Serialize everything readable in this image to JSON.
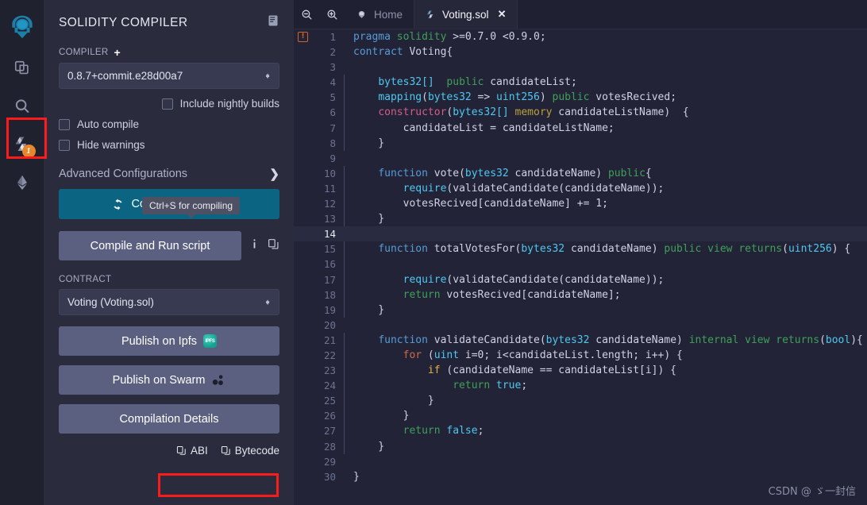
{
  "rail": {
    "items": [
      {
        "name": "remix-logo",
        "label": "Remix"
      },
      {
        "name": "file-explorer",
        "label": "File explorers"
      },
      {
        "name": "search",
        "label": "Search in files"
      },
      {
        "name": "solidity-compiler",
        "label": "Solidity compiler",
        "badge": "1"
      },
      {
        "name": "deploy-run",
        "label": "Deploy & run transactions"
      }
    ]
  },
  "panel": {
    "title": "SOLIDITY COMPILER",
    "header_icon": "book-icon",
    "compiler_label": "COMPILER",
    "compiler_add_icon": "plus-icon",
    "compiler_version": "0.8.7+commit.e28d00a7",
    "nightly_label": "Include nightly builds",
    "auto_compile_label": "Auto compile",
    "hide_warnings_label": "Hide warnings",
    "advanced_label": "Advanced Configurations",
    "tooltip": "Ctrl+S for compiling",
    "compile_button": "Compile Voting.sol",
    "compile_icon": "refresh-icon",
    "run_script_button": "Compile and Run script",
    "info_icon": "info-icon",
    "copy_icon": "copy-icon",
    "contract_label": "CONTRACT",
    "contract_value": "Voting (Voting.sol)",
    "publish_ipfs": "Publish on Ipfs",
    "publish_swarm": "Publish on Swarm",
    "compilation_details": "Compilation Details",
    "abi_label": "ABI",
    "bytecode_label": "Bytecode"
  },
  "editor": {
    "zoom_out_icon": "zoom-out-icon",
    "zoom_in_icon": "zoom-in-icon",
    "tabs": [
      {
        "label": "Home",
        "icon": "remix-home-icon",
        "active": false,
        "closable": false
      },
      {
        "label": "Voting.sol",
        "icon": "solidity-file-icon",
        "active": true,
        "closable": true,
        "close_icon": "close-icon"
      }
    ],
    "active_line": 14,
    "warning_line": 1,
    "warning_icon": "warning-marker-icon",
    "lines": [
      {
        "n": 1,
        "tokens": [
          {
            "t": "pragma ",
            "c": "t-kw"
          },
          {
            "t": "solidity ",
            "c": "t-mod"
          },
          {
            "t": ">=0.7.0 <0.9.0;",
            "c": "t-plain"
          }
        ]
      },
      {
        "n": 2,
        "tokens": [
          {
            "t": "contract ",
            "c": "t-kw"
          },
          {
            "t": "Voting{",
            "c": "t-plain"
          }
        ]
      },
      {
        "n": 3,
        "tokens": []
      },
      {
        "n": 4,
        "indent": 1,
        "tokens": [
          {
            "t": "    ",
            "c": "t-plain"
          },
          {
            "t": "bytes32[]",
            "c": "t-type"
          },
          {
            "t": "  ",
            "c": "t-plain"
          },
          {
            "t": "public",
            "c": "t-mod"
          },
          {
            "t": " candidateList;",
            "c": "t-plain"
          }
        ]
      },
      {
        "n": 5,
        "indent": 1,
        "tokens": [
          {
            "t": "    ",
            "c": "t-plain"
          },
          {
            "t": "mapping",
            "c": "t-type"
          },
          {
            "t": "(",
            "c": "t-plain"
          },
          {
            "t": "bytes32",
            "c": "t-type"
          },
          {
            "t": " => ",
            "c": "t-plain"
          },
          {
            "t": "uint256",
            "c": "t-type"
          },
          {
            "t": ") ",
            "c": "t-plain"
          },
          {
            "t": "public",
            "c": "t-mod"
          },
          {
            "t": " votesRecived;",
            "c": "t-plain"
          }
        ]
      },
      {
        "n": 6,
        "indent": 1,
        "tokens": [
          {
            "t": "    ",
            "c": "t-plain"
          },
          {
            "t": "constructor",
            "c": "t-fn"
          },
          {
            "t": "(",
            "c": "t-plain"
          },
          {
            "t": "bytes32[]",
            "c": "t-type"
          },
          {
            "t": " ",
            "c": "t-plain"
          },
          {
            "t": "memory",
            "c": "t-mem"
          },
          {
            "t": " candidateListName)  {",
            "c": "t-plain"
          }
        ]
      },
      {
        "n": 7,
        "indent": 2,
        "tokens": [
          {
            "t": "        candidateList = candidateListName;",
            "c": "t-plain"
          }
        ]
      },
      {
        "n": 8,
        "indent": 1,
        "tokens": [
          {
            "t": "    }",
            "c": "t-plain"
          }
        ]
      },
      {
        "n": 9,
        "tokens": []
      },
      {
        "n": 10,
        "indent": 1,
        "tokens": [
          {
            "t": "    ",
            "c": "t-plain"
          },
          {
            "t": "function",
            "c": "t-kw"
          },
          {
            "t": " vote(",
            "c": "t-plain"
          },
          {
            "t": "bytes32",
            "c": "t-type"
          },
          {
            "t": " candidateName) ",
            "c": "t-plain"
          },
          {
            "t": "public",
            "c": "t-mod"
          },
          {
            "t": "{",
            "c": "t-plain"
          }
        ]
      },
      {
        "n": 11,
        "indent": 2,
        "tokens": [
          {
            "t": "        ",
            "c": "t-plain"
          },
          {
            "t": "require",
            "c": "t-type"
          },
          {
            "t": "(validateCandidate(candidateName));",
            "c": "t-plain"
          }
        ]
      },
      {
        "n": 12,
        "indent": 2,
        "tokens": [
          {
            "t": "        votesRecived[candidateName] += 1;",
            "c": "t-plain"
          }
        ]
      },
      {
        "n": 13,
        "indent": 1,
        "tokens": [
          {
            "t": "    }",
            "c": "t-plain"
          }
        ]
      },
      {
        "n": 14,
        "tokens": []
      },
      {
        "n": 15,
        "indent": 1,
        "tokens": [
          {
            "t": "    ",
            "c": "t-plain"
          },
          {
            "t": "function",
            "c": "t-kw"
          },
          {
            "t": " totalVotesFor(",
            "c": "t-plain"
          },
          {
            "t": "bytes32",
            "c": "t-type"
          },
          {
            "t": " candidateName) ",
            "c": "t-plain"
          },
          {
            "t": "public",
            "c": "t-mod"
          },
          {
            "t": " ",
            "c": "t-plain"
          },
          {
            "t": "view",
            "c": "t-mod"
          },
          {
            "t": " ",
            "c": "t-plain"
          },
          {
            "t": "returns",
            "c": "t-ret"
          },
          {
            "t": "(",
            "c": "t-plain"
          },
          {
            "t": "uint256",
            "c": "t-type"
          },
          {
            "t": ") {",
            "c": "t-plain"
          }
        ]
      },
      {
        "n": 16,
        "indent": 2,
        "tokens": []
      },
      {
        "n": 17,
        "indent": 2,
        "tokens": [
          {
            "t": "        ",
            "c": "t-plain"
          },
          {
            "t": "require",
            "c": "t-type"
          },
          {
            "t": "(validateCandidate(candidateName));",
            "c": "t-plain"
          }
        ]
      },
      {
        "n": 18,
        "indent": 2,
        "tokens": [
          {
            "t": "        ",
            "c": "t-plain"
          },
          {
            "t": "return",
            "c": "t-ret"
          },
          {
            "t": " votesRecived[candidateName];",
            "c": "t-plain"
          }
        ]
      },
      {
        "n": 19,
        "indent": 1,
        "tokens": [
          {
            "t": "    }",
            "c": "t-plain"
          }
        ]
      },
      {
        "n": 20,
        "tokens": []
      },
      {
        "n": 21,
        "indent": 1,
        "tokens": [
          {
            "t": "    ",
            "c": "t-plain"
          },
          {
            "t": "function",
            "c": "t-kw"
          },
          {
            "t": " validateCandidate(",
            "c": "t-plain"
          },
          {
            "t": "bytes32",
            "c": "t-type"
          },
          {
            "t": " candidateName) ",
            "c": "t-plain"
          },
          {
            "t": "internal",
            "c": "t-mod"
          },
          {
            "t": " ",
            "c": "t-plain"
          },
          {
            "t": "view",
            "c": "t-mod"
          },
          {
            "t": " ",
            "c": "t-plain"
          },
          {
            "t": "returns",
            "c": "t-ret"
          },
          {
            "t": "(",
            "c": "t-plain"
          },
          {
            "t": "bool",
            "c": "t-type"
          },
          {
            "t": "){",
            "c": "t-plain"
          }
        ]
      },
      {
        "n": 22,
        "indent": 2,
        "tokens": [
          {
            "t": "        ",
            "c": "t-plain"
          },
          {
            "t": "for",
            "c": "t-ctl"
          },
          {
            "t": " (",
            "c": "t-plain"
          },
          {
            "t": "uint",
            "c": "t-type"
          },
          {
            "t": " i=0; i<candidateList.length; i++) {",
            "c": "t-plain"
          }
        ]
      },
      {
        "n": 23,
        "indent": 3,
        "tokens": [
          {
            "t": "            ",
            "c": "t-plain"
          },
          {
            "t": "if",
            "c": "t-if"
          },
          {
            "t": " (candidateName == candidateList[i]) {",
            "c": "t-plain"
          }
        ]
      },
      {
        "n": 24,
        "indent": 4,
        "tokens": [
          {
            "t": "                ",
            "c": "t-plain"
          },
          {
            "t": "return",
            "c": "t-ret"
          },
          {
            "t": " ",
            "c": "t-plain"
          },
          {
            "t": "true",
            "c": "t-bool"
          },
          {
            "t": ";",
            "c": "t-plain"
          }
        ]
      },
      {
        "n": 25,
        "indent": 3,
        "tokens": [
          {
            "t": "            }",
            "c": "t-plain"
          }
        ]
      },
      {
        "n": 26,
        "indent": 2,
        "tokens": [
          {
            "t": "        }",
            "c": "t-plain"
          }
        ]
      },
      {
        "n": 27,
        "indent": 2,
        "tokens": [
          {
            "t": "        ",
            "c": "t-plain"
          },
          {
            "t": "return",
            "c": "t-ret"
          },
          {
            "t": " ",
            "c": "t-plain"
          },
          {
            "t": "false",
            "c": "t-bool"
          },
          {
            "t": ";",
            "c": "t-plain"
          }
        ]
      },
      {
        "n": 28,
        "indent": 1,
        "tokens": [
          {
            "t": "    }",
            "c": "t-plain"
          }
        ]
      },
      {
        "n": 29,
        "tokens": []
      },
      {
        "n": 30,
        "tokens": [
          {
            "t": "}",
            "c": "t-plain"
          }
        ]
      }
    ]
  },
  "watermark": "CSDN @ ゞ一封信",
  "colors": {
    "panel_bg": "#2a2b3d",
    "editor_bg": "#222336",
    "rail_bg": "#20212f",
    "compile_button": "#0b6482",
    "grey_button": "#5c6080",
    "highlight_box": "#fb1b1b",
    "badge": "#e8872a"
  }
}
